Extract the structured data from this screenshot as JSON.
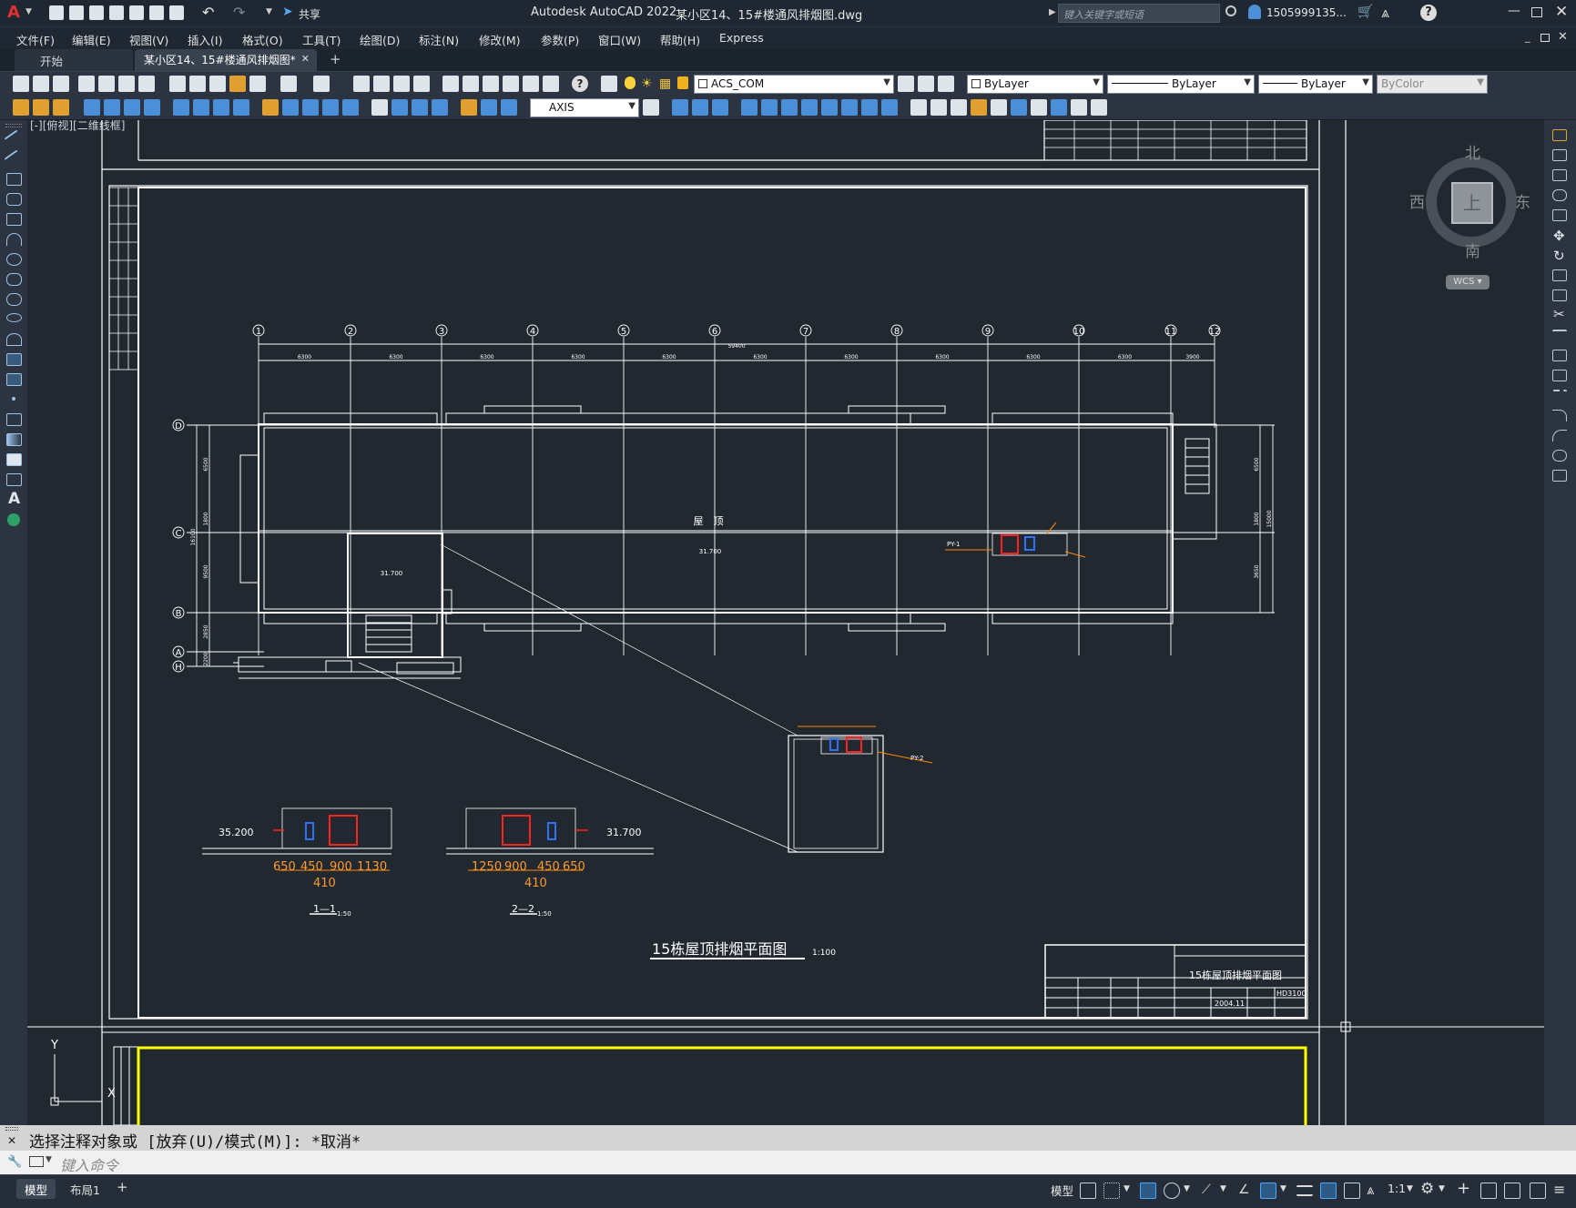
{
  "titlebar": {
    "app_title": "Autodesk AutoCAD 2022",
    "file_title": "某小区14、15#楼通风排烟图.dwg",
    "share_label": "共享",
    "search_placeholder": "键入关键字或短语",
    "user_label": "1505999135..."
  },
  "menu": {
    "items": [
      "文件(F)",
      "编辑(E)",
      "视图(V)",
      "插入(I)",
      "格式(O)",
      "工具(T)",
      "绘图(D)",
      "标注(N)",
      "修改(M)",
      "参数(P)",
      "窗口(W)",
      "帮助(H)",
      "Express"
    ]
  },
  "tabs": {
    "start_label": "开始",
    "doc_label": "某小区14、15#楼通风排烟图*",
    "close_glyph": "✕",
    "new_glyph": "+"
  },
  "toolbar": {
    "layer_name": "ACS_COM",
    "color": "ByLayer",
    "linetype": "ByLayer",
    "lineweight": "ByLayer",
    "plotstyle": "ByColor",
    "dimstyle": "AXIS"
  },
  "viewport": {
    "label": "[-][俯视][二维线框]"
  },
  "viewcube": {
    "north": "北",
    "south": "南",
    "east": "东",
    "west": "西",
    "face": "上",
    "wcs": "WCS"
  },
  "drawing": {
    "grid_numbers": [
      "1",
      "2",
      "3",
      "4",
      "5",
      "6",
      "7",
      "8",
      "9",
      "10",
      "11",
      "12"
    ],
    "grid_letters": [
      "D",
      "C",
      "B",
      "A",
      "H"
    ],
    "bay_dims": [
      "6300",
      "6300",
      "6300",
      "6300",
      "6300",
      "6300",
      "6300",
      "6300",
      "6300",
      "6300",
      "3900"
    ],
    "total_dim": "59400",
    "roof_label": "屋　顶",
    "roof_elev": "31.700",
    "stair_elev": "31.700",
    "section1_elev": "35.200",
    "section2_elev": "31.700",
    "section1_dims": [
      "650",
      "450",
      "900",
      "1130"
    ],
    "section1_sub": "410",
    "section2_dims": [
      "1250",
      "900",
      "450",
      "650"
    ],
    "section2_sub": "410",
    "section1_title": "1—1",
    "section2_title": "2—2",
    "section_scale": "1:50",
    "plan_title": "15栋屋顶排烟平面图",
    "plan_scale": "1:100",
    "tb_title": "15栋屋顶排烟平面图",
    "tb_no": "HD3100",
    "tb_date": "2004.11",
    "fan1_tag": "PY-1",
    "fan2_tag": "PY-2",
    "left_dims": [
      "6500",
      "1800",
      "9500",
      "2850",
      "2200"
    ],
    "right_dims": [
      "6500",
      "1800",
      "3650"
    ],
    "right_total": "15000",
    "left_total": "16100"
  },
  "command": {
    "history": "选择注释对象或 [放弃(U)/模式(M)]: *取消*",
    "placeholder": "键入命令"
  },
  "status": {
    "model_tab": "模型",
    "layout_tab": "布局1",
    "add_tab": "+",
    "model_btn": "模型",
    "scale": "1:1"
  },
  "ucs": {
    "y": "Y",
    "x": "X"
  }
}
